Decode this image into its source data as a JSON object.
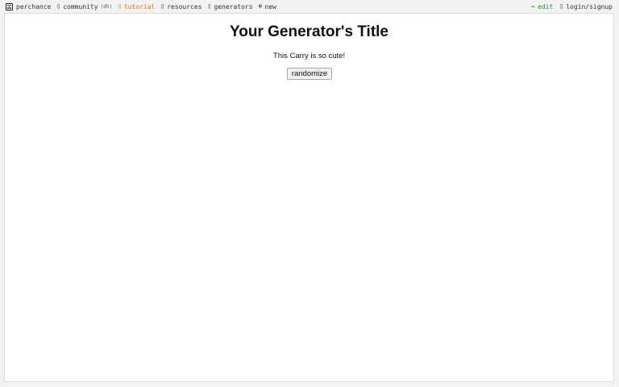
{
  "nav": {
    "brand": "perchance",
    "community": "community",
    "community_badge": "(dh)",
    "tutorial": "tutorial",
    "resources": "resources",
    "generators": "generators",
    "new": "new",
    "edit": "edit",
    "login": "login/signup",
    "colors": {
      "tutorial": "#e07b00",
      "edit": "#2a8a2a"
    }
  },
  "generator": {
    "title": "Your Generator's Title",
    "output": "This Carry is so cute!",
    "button_label": "randomize"
  }
}
